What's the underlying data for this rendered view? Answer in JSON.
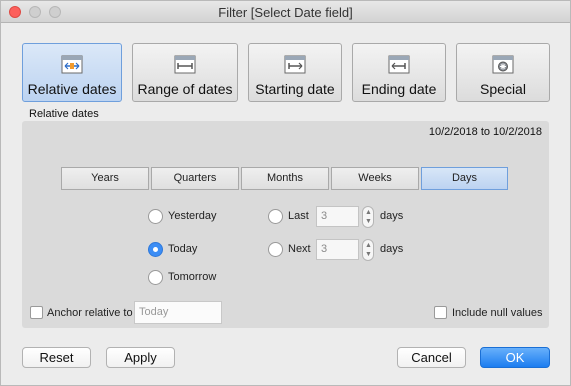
{
  "window": {
    "title": "Filter [Select Date field]"
  },
  "tabs": [
    {
      "label": "Relative dates",
      "icon": "calendar-relative-icon",
      "active": true
    },
    {
      "label": "Range of dates",
      "icon": "calendar-range-icon",
      "active": false
    },
    {
      "label": "Starting date",
      "icon": "calendar-start-icon",
      "active": false
    },
    {
      "label": "Ending date",
      "icon": "calendar-end-icon",
      "active": false
    },
    {
      "label": "Special",
      "icon": "calendar-special-icon",
      "active": false
    }
  ],
  "panel": {
    "header": "Relative dates",
    "range_text": "10/2/2018 to 10/2/2018",
    "units": [
      "Years",
      "Quarters",
      "Months",
      "Weeks",
      "Days"
    ],
    "selected_unit": "Days",
    "options": {
      "yesterday": "Yesterday",
      "today": "Today",
      "tomorrow": "Tomorrow",
      "last": "Last",
      "next": "Next"
    },
    "selected_option": "Today",
    "last_value": "3",
    "next_value": "3",
    "unit_suffix": "days",
    "anchor_label": "Anchor relative to",
    "anchor_placeholder": "Today",
    "include_null_label": "Include null values"
  },
  "footer": {
    "reset": "Reset",
    "apply": "Apply",
    "cancel": "Cancel",
    "ok": "OK"
  },
  "colors": {
    "accent": "#3b8df5",
    "close": "#fc605c",
    "active_border": "#6f9fdc"
  }
}
